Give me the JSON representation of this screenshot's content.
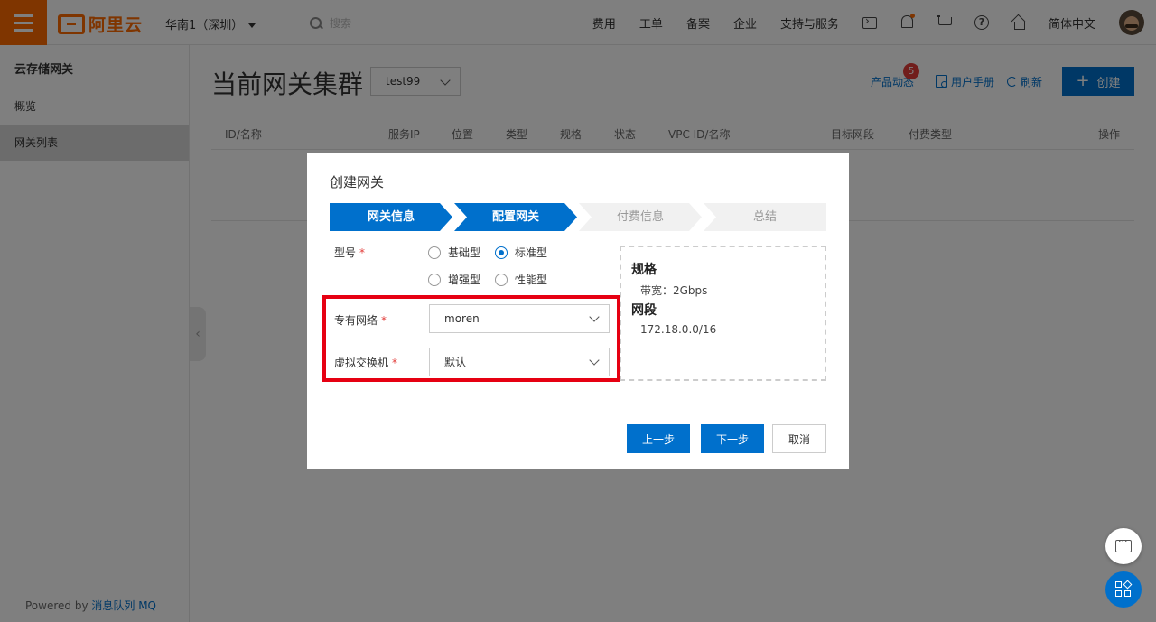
{
  "header": {
    "brand": "阿里云",
    "region": "华南1（深圳）",
    "search_placeholder": "搜索",
    "nav": [
      "费用",
      "工单",
      "备案",
      "企业",
      "支持与服务"
    ],
    "lang": "简体中文",
    "icons": [
      "terminal-icon",
      "bell-icon",
      "cart-icon",
      "help-icon",
      "home-icon"
    ],
    "accent": "#ff6a00"
  },
  "sidebar": {
    "title": "云存储网关",
    "items": [
      {
        "label": "概览",
        "active": false
      },
      {
        "label": "网关列表",
        "active": true
      }
    ],
    "footer_prefix": "Powered by ",
    "footer_link": "消息队列 MQ"
  },
  "main": {
    "title": "当前网关集群",
    "cluster": "test99",
    "toolbar": {
      "news": "产品动态",
      "news_badge": "5",
      "manual": "用户手册",
      "refresh": "刷新",
      "create": "创建"
    },
    "columns": [
      "ID/名称",
      "服务IP",
      "位置",
      "类型",
      "规格",
      "状态",
      "VPC ID/名称",
      "目标网段",
      "付费类型",
      "操作"
    ]
  },
  "dialog": {
    "title": "创建网关",
    "steps": [
      "网关信息",
      "配置网关",
      "付费信息",
      "总结"
    ],
    "current_step": 2,
    "model_label": "型号",
    "model_options": [
      "基础型",
      "标准型",
      "增强型",
      "性能型"
    ],
    "model_selected": "标准型",
    "vpc_label": "专有网络",
    "vpc_value": "moren",
    "vswitch_label": "虚拟交换机",
    "vswitch_value": "默认",
    "spec": {
      "spec_heading": "规格",
      "bandwidth": "带宽：2Gbps",
      "segment_heading": "网段",
      "segment": "172.18.0.0/16"
    },
    "prev_button": "上一步",
    "next_button": "下一步",
    "cancel_button": "取消"
  },
  "colors": {
    "primary": "#0070cc",
    "highlight": "#e60012",
    "badge": "#e23c39"
  }
}
